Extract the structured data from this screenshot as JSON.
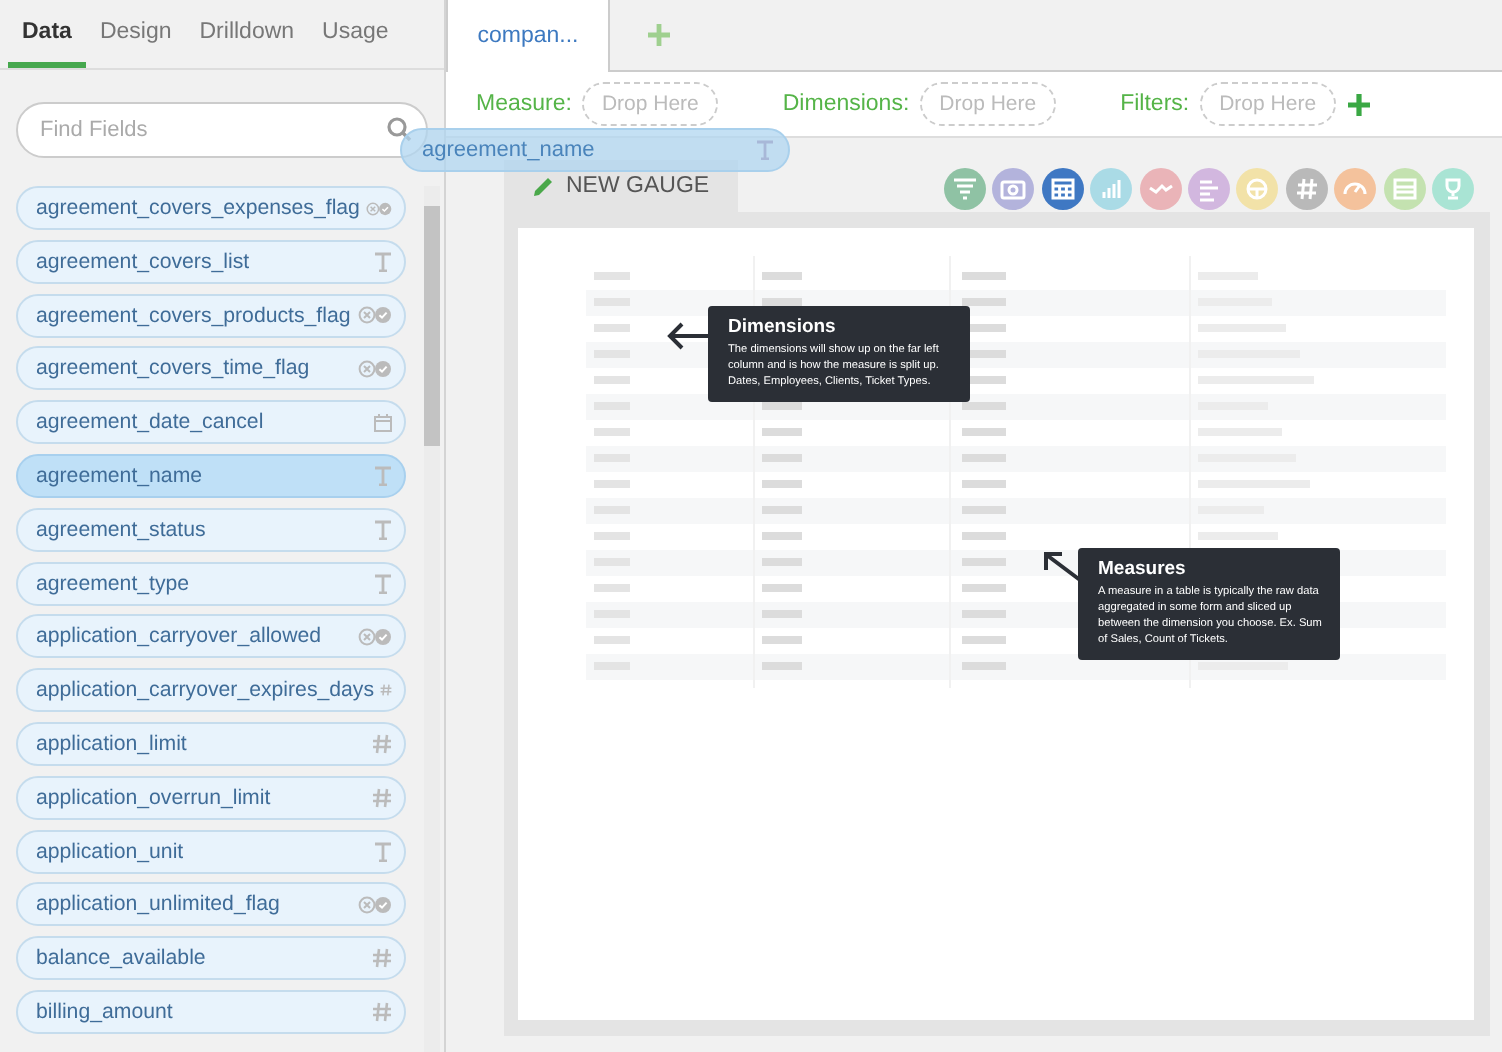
{
  "sidebar": {
    "tabs": [
      {
        "label": "Data",
        "selected": true
      },
      {
        "label": "Design",
        "selected": false
      },
      {
        "label": "Drilldown",
        "selected": false
      },
      {
        "label": "Usage",
        "selected": false
      }
    ],
    "search": {
      "placeholder": "Find Fields"
    },
    "fields": [
      {
        "name": "agreement_covers_expenses_flag",
        "kind": "boolean",
        "selected": false
      },
      {
        "name": "agreement_covers_list",
        "kind": "text",
        "selected": false
      },
      {
        "name": "agreement_covers_products_flag",
        "kind": "boolean",
        "selected": false
      },
      {
        "name": "agreement_covers_time_flag",
        "kind": "boolean",
        "selected": false
      },
      {
        "name": "agreement_date_cancel",
        "kind": "date",
        "selected": false
      },
      {
        "name": "agreement_name",
        "kind": "text",
        "selected": true
      },
      {
        "name": "agreement_status",
        "kind": "text",
        "selected": false
      },
      {
        "name": "agreement_type",
        "kind": "text",
        "selected": false
      },
      {
        "name": "application_carryover_allowed",
        "kind": "boolean",
        "selected": false
      },
      {
        "name": "application_carryover_expires_days",
        "kind": "number",
        "selected": false
      },
      {
        "name": "application_limit",
        "kind": "number",
        "selected": false
      },
      {
        "name": "application_overrun_limit",
        "kind": "number",
        "selected": false
      },
      {
        "name": "application_unit",
        "kind": "text",
        "selected": false
      },
      {
        "name": "application_unlimited_flag",
        "kind": "boolean",
        "selected": false
      },
      {
        "name": "balance_available",
        "kind": "number",
        "selected": false
      },
      {
        "name": "billing_amount",
        "kind": "number",
        "selected": false
      }
    ]
  },
  "drag_item": {
    "name": "agreement_name",
    "kind": "text"
  },
  "doc_tabs": [
    {
      "label": "compan...",
      "selected": true
    }
  ],
  "drop_zones": [
    {
      "label": "Measure:",
      "placeholder": "Drop Here"
    },
    {
      "label": "Dimensions:",
      "placeholder": "Drop Here"
    },
    {
      "label": "Filters:",
      "placeholder": "Drop Here"
    }
  ],
  "gauge_tab": {
    "label": "NEW GAUGE"
  },
  "chart_types": [
    {
      "kind": "funnel",
      "color": "#8fc2a4"
    },
    {
      "kind": "camera",
      "color": "#b3b3dc"
    },
    {
      "kind": "table",
      "color": "#3f78c3"
    },
    {
      "kind": "bar",
      "color": "#aadbe6"
    },
    {
      "kind": "line",
      "color": "#eab4b8"
    },
    {
      "kind": "hbar",
      "color": "#d2b7df"
    },
    {
      "kind": "wheel",
      "color": "#f2e2a8"
    },
    {
      "kind": "number",
      "color": "#b9b9b9"
    },
    {
      "kind": "gauge",
      "color": "#f4c29c"
    },
    {
      "kind": "card",
      "color": "#c4e2b0"
    },
    {
      "kind": "trophy",
      "color": "#a9e4d4"
    }
  ],
  "tooltips": [
    {
      "title": "Dimensions",
      "text": "The dimensions will show up on the far left column and is how the measure is split up. Dates, Employees, Clients, Ticket Types."
    },
    {
      "title": "Measures",
      "text": "A measure in a table is typically the raw data aggregated in some form and sliced up between the dimension you choose. Ex. Sum of Sales, Count of Tickets."
    }
  ]
}
